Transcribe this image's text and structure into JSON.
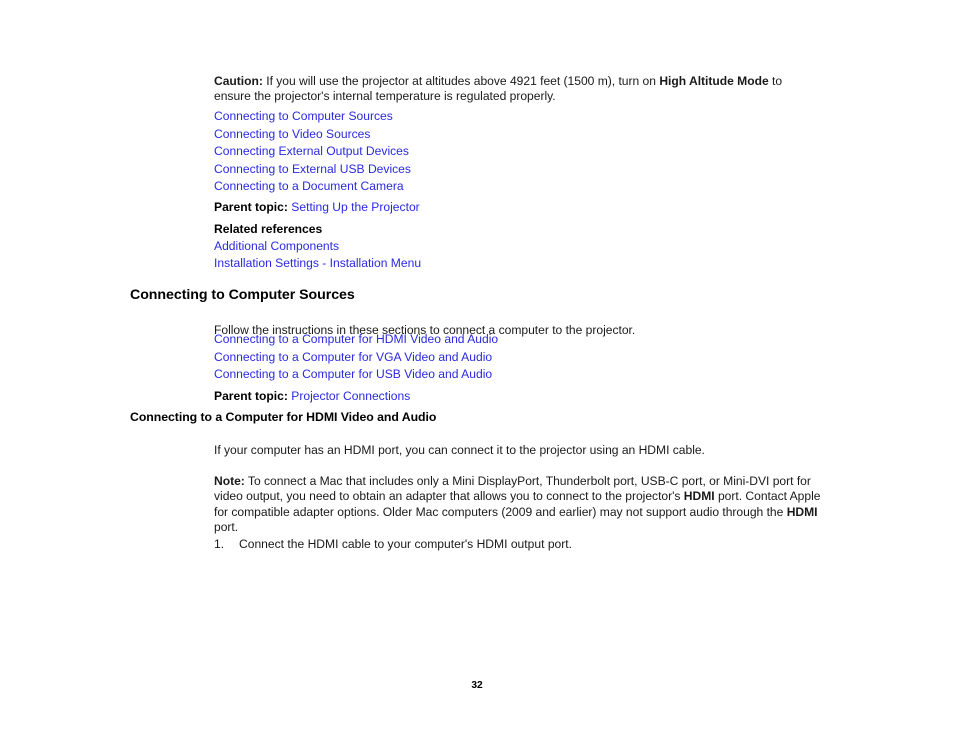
{
  "document": {
    "page_number": "32",
    "link_color": "#2a2ae0",
    "text_color": "#1a1a1a"
  },
  "caution": {
    "label": "Caution:",
    "text_before": " If you will use the projector at altitudes above 4921 feet (1500 m), turn on ",
    "emphasis": "High Altitude Mode",
    "text_after": " to ensure the projector's internal temperature is regulated properly."
  },
  "topic_links": [
    {
      "label": "Connecting to Computer Sources"
    },
    {
      "label": "Connecting to Video Sources"
    },
    {
      "label": "Connecting External Output Devices"
    },
    {
      "label": "Connecting to External USB Devices"
    },
    {
      "label": "Connecting to a Document Camera"
    }
  ],
  "parent_topic_1": {
    "label": "Parent topic:",
    "link": "Setting Up the Projector"
  },
  "related_references": {
    "heading": "Related references",
    "links": [
      {
        "label": "Additional Components"
      },
      {
        "label": "Installation Settings - Installation Menu"
      }
    ]
  },
  "section": {
    "heading": "Connecting to Computer Sources",
    "intro": "Follow the instructions in these sections to connect a computer to the projector.",
    "links": [
      {
        "label": "Connecting to a Computer for HDMI Video and Audio"
      },
      {
        "label": "Connecting to a Computer for VGA Video and Audio"
      },
      {
        "label": "Connecting to a Computer for USB Video and Audio"
      }
    ],
    "parent_topic": {
      "label": "Parent topic:",
      "link": "Projector Connections"
    }
  },
  "subsection": {
    "heading": "Connecting to a Computer for HDMI Video and Audio",
    "intro": "If your computer has an HDMI port, you can connect it to the projector using an HDMI cable.",
    "note": {
      "label": "Note:",
      "part1": " To connect a Mac that includes only a Mini DisplayPort, Thunderbolt port, USB-C port, or Mini-DVI port for video output, you need to obtain an adapter that allows you to connect to the projector's ",
      "emphasis1": "HDMI",
      "part2": " port. Contact Apple for compatible adapter options. Older Mac computers (2009 and earlier) may not support audio through the ",
      "emphasis2": "HDMI",
      "part3": " port."
    },
    "steps": [
      {
        "number": "1.",
        "text": "Connect the HDMI cable to your computer's HDMI output port."
      }
    ]
  }
}
